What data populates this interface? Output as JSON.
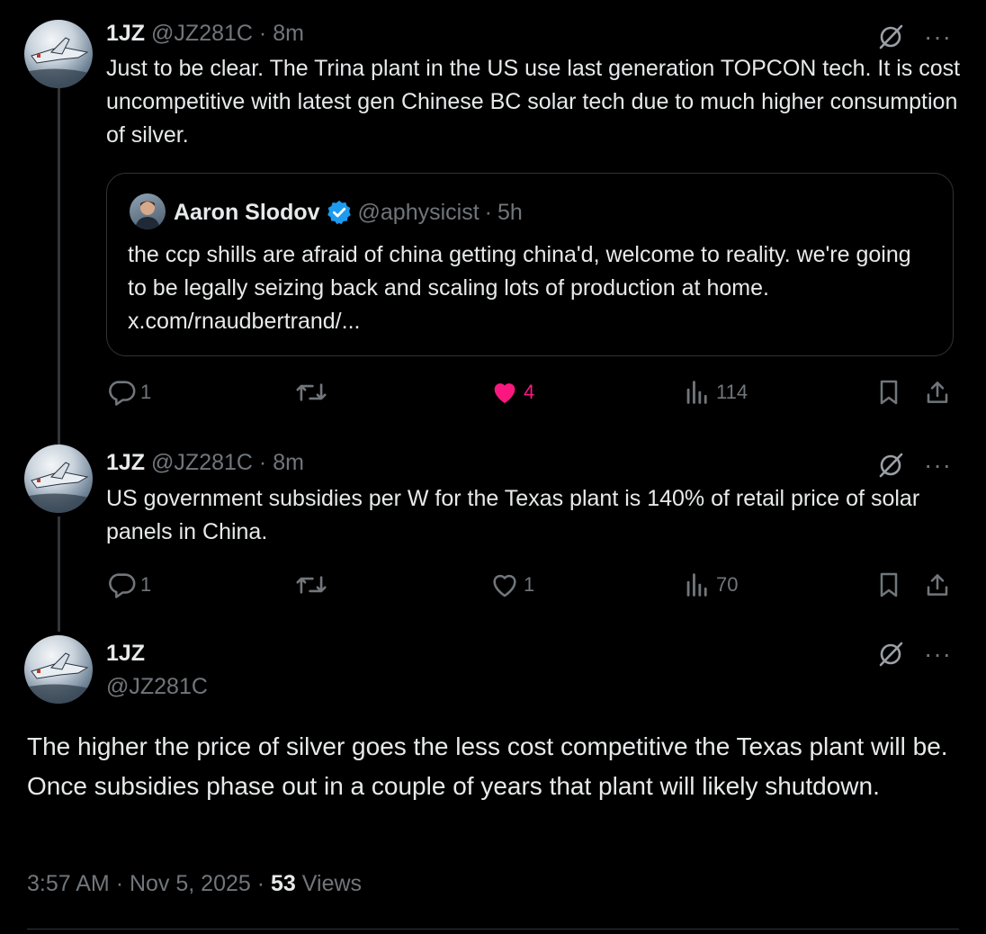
{
  "tweet1": {
    "name": "1JZ",
    "handle": "@JZ281C",
    "sep": "·",
    "time": "8m",
    "text": "Just to be clear. The Trina plant in the US use last generation TOPCON tech. It is cost uncompetitive with latest gen Chinese BC solar tech due to much higher consumption of silver.",
    "quote": {
      "name": "Aaron Slodov",
      "handle": "@aphysicist",
      "sep": "·",
      "time": "5h",
      "text": "the ccp shills are afraid of china getting china'd, welcome to reality. we're going to be legally seizing back and scaling lots of production at home. x.com/rnaudbertrand/..."
    },
    "replies": "1",
    "likes": "4",
    "views": "114"
  },
  "tweet2": {
    "name": "1JZ",
    "handle": "@JZ281C",
    "sep": "·",
    "time": "8m",
    "text": "US government subsidies per W for the Texas plant is 140% of retail price of solar panels in China.",
    "replies": "1",
    "likes": "1",
    "views": "70"
  },
  "main": {
    "name": "1JZ",
    "handle": "@JZ281C",
    "text": "The higher the price of silver goes the less cost competitive the Texas plant will be. Once subsidies phase out in a couple of years that plant will likely shutdown.",
    "time": "3:57 AM",
    "date": "Nov 5, 2025",
    "sep": "·",
    "views_count": "53",
    "views_label": "Views"
  },
  "colors": {
    "background": "#000000",
    "text": "#e7e9ea",
    "muted": "#71767b",
    "like_active": "#f91880",
    "verified": "#1d9bf0",
    "border": "#2f3336"
  },
  "icons": [
    "avatar-image",
    "grok-icon",
    "more-icon",
    "verified-badge-icon",
    "reply-icon",
    "repost-icon",
    "like-icon",
    "views-icon",
    "bookmark-icon",
    "share-icon"
  ]
}
